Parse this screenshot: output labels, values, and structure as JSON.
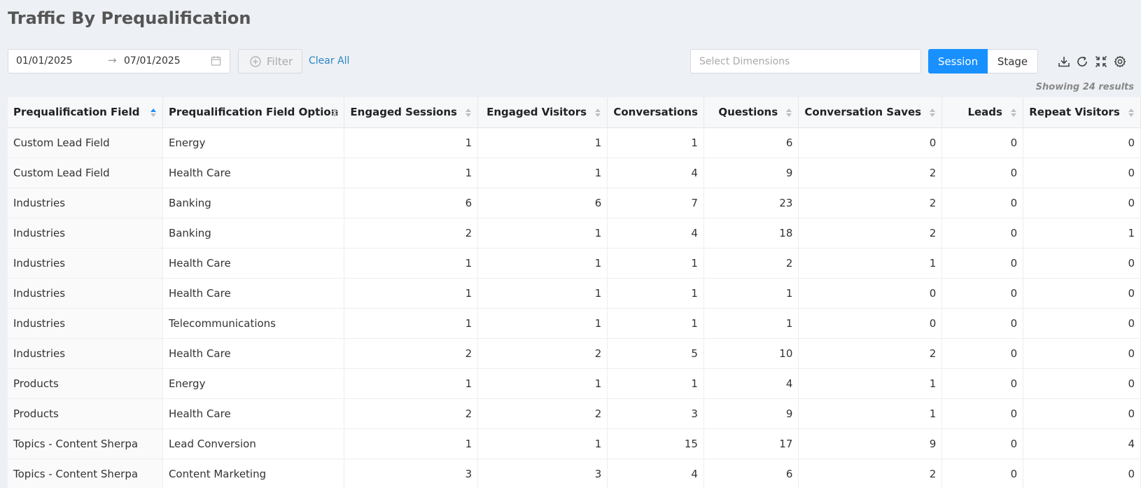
{
  "page": {
    "title": "Traffic By Prequalification"
  },
  "toolbar": {
    "date_start": "01/01/2025",
    "date_arrow": "→",
    "date_end": "07/01/2025",
    "filter_label": "Filter",
    "clear_all_label": "Clear All",
    "dimensions_placeholder": "Select Dimensions",
    "session_label": "Session",
    "stage_label": "Stage",
    "accent_color": "#1890ff",
    "icons": [
      "download-icon",
      "refresh-icon",
      "fullscreen-icon",
      "settings-icon"
    ]
  },
  "results": {
    "showing_text": "Showing 24 results"
  },
  "table": {
    "columns": [
      "Prequalification Field",
      "Prequalification Field Option",
      "Engaged Sessions",
      "Engaged Visitors",
      "Conversations",
      "Questions",
      "Conversation Saves",
      "Leads",
      "Repeat Visitors"
    ],
    "rows": [
      [
        "Custom Lead Field",
        "Energy",
        "1",
        "1",
        "1",
        "6",
        "0",
        "0",
        "0"
      ],
      [
        "Custom Lead Field",
        "Health Care",
        "1",
        "1",
        "4",
        "9",
        "2",
        "0",
        "0"
      ],
      [
        "Industries",
        "Banking",
        "6",
        "6",
        "7",
        "23",
        "2",
        "0",
        "0"
      ],
      [
        "Industries",
        "Banking",
        "2",
        "1",
        "4",
        "18",
        "2",
        "0",
        "1"
      ],
      [
        "Industries",
        "Health Care",
        "1",
        "1",
        "1",
        "2",
        "1",
        "0",
        "0"
      ],
      [
        "Industries",
        "Health Care",
        "1",
        "1",
        "1",
        "1",
        "0",
        "0",
        "0"
      ],
      [
        "Industries",
        "Telecommunications",
        "1",
        "1",
        "1",
        "1",
        "0",
        "0",
        "0"
      ],
      [
        "Industries",
        "Health Care",
        "2",
        "2",
        "5",
        "10",
        "2",
        "0",
        "0"
      ],
      [
        "Products",
        "Energy",
        "1",
        "1",
        "1",
        "4",
        "1",
        "0",
        "0"
      ],
      [
        "Products",
        "Health Care",
        "2",
        "2",
        "3",
        "9",
        "1",
        "0",
        "0"
      ],
      [
        "Topics - Content Sherpa",
        "Lead Conversion",
        "1",
        "1",
        "15",
        "17",
        "9",
        "0",
        "4"
      ],
      [
        "Topics - Content Sherpa",
        "Content Marketing",
        "3",
        "3",
        "4",
        "6",
        "2",
        "0",
        "0"
      ]
    ]
  }
}
